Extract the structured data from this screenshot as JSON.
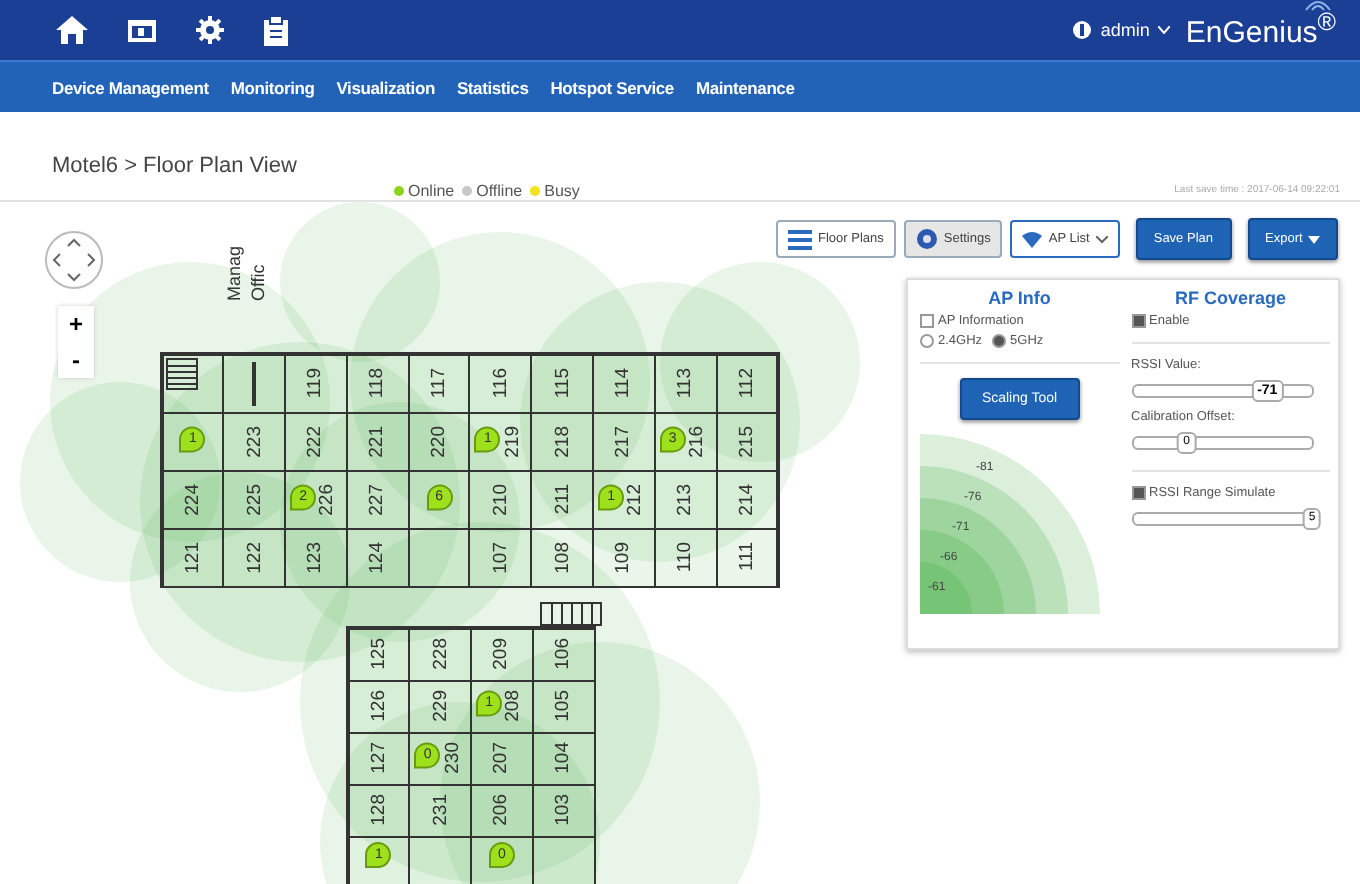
{
  "header": {
    "user": "admin",
    "logo": "EnGenius$^{®}$"
  },
  "nav": [
    "Device Management",
    "Monitoring",
    "Visualization",
    "Statistics",
    "Hotspot Service",
    "Maintenance"
  ],
  "breadcrumb": "Motel6 > Floor Plan View",
  "legend": [
    {
      "label": "Online",
      "color": "#8fd41c"
    },
    {
      "label": "Offline",
      "color": "#c8c8c8"
    },
    {
      "label": "Busy",
      "color": "#f2e21a"
    }
  ],
  "last_save": "Last save time : 2017-06-14 09:22:01",
  "zoom": {
    "in": "+",
    "out": "-"
  },
  "office_label": [
    "Manag",
    "Offic"
  ],
  "toolbar": {
    "floor_plans": "Floor Plans",
    "settings": "Settings",
    "ap_list": "AP List",
    "save": "Save Plan",
    "export": "Export"
  },
  "wing_a": [
    [
      {
        "kind": "stairs"
      },
      {
        "kind": "office"
      },
      {
        "kind": "room",
        "label": "119"
      },
      {
        "kind": "room",
        "label": "118"
      },
      {
        "kind": "room",
        "label": "117"
      },
      {
        "kind": "room",
        "label": "116"
      },
      {
        "kind": "room",
        "label": "115"
      },
      {
        "kind": "room",
        "label": "114"
      },
      {
        "kind": "room",
        "label": "113"
      },
      {
        "kind": "room",
        "label": "112"
      }
    ],
    [
      {
        "kind": "blank",
        "pin": "1"
      },
      {
        "kind": "room",
        "label": "223"
      },
      {
        "kind": "room",
        "label": "222"
      },
      {
        "kind": "room",
        "label": "221"
      },
      {
        "kind": "room",
        "label": "220"
      },
      {
        "kind": "room",
        "label": "219",
        "pin": "1"
      },
      {
        "kind": "room",
        "label": "218"
      },
      {
        "kind": "room",
        "label": "217"
      },
      {
        "kind": "room",
        "label": "216",
        "pin": "3"
      },
      {
        "kind": "room",
        "label": "215"
      }
    ],
    [
      {
        "kind": "room",
        "label": "224"
      },
      {
        "kind": "room",
        "label": "225"
      },
      {
        "kind": "room",
        "label": "226",
        "pin": "2"
      },
      {
        "kind": "room",
        "label": "227"
      },
      {
        "kind": "blank",
        "pin": "6"
      },
      {
        "kind": "room",
        "label": "210"
      },
      {
        "kind": "room",
        "label": "211"
      },
      {
        "kind": "room",
        "label": "212",
        "pin": "1"
      },
      {
        "kind": "room",
        "label": "213"
      },
      {
        "kind": "room",
        "label": "214"
      }
    ],
    [
      {
        "kind": "room",
        "label": "121"
      },
      {
        "kind": "room",
        "label": "122"
      },
      {
        "kind": "room",
        "label": "123"
      },
      {
        "kind": "room",
        "label": "124"
      },
      {
        "kind": "blank"
      },
      {
        "kind": "room",
        "label": "107"
      },
      {
        "kind": "room",
        "label": "108"
      },
      {
        "kind": "room",
        "label": "109"
      },
      {
        "kind": "room",
        "label": "110"
      },
      {
        "kind": "room",
        "label": "111"
      }
    ]
  ],
  "wing_b": [
    [
      {
        "kind": "room",
        "label": "125"
      },
      {
        "kind": "room",
        "label": "228"
      },
      {
        "kind": "room",
        "label": "209"
      },
      {
        "kind": "room",
        "label": "106"
      }
    ],
    [
      {
        "kind": "room",
        "label": "126"
      },
      {
        "kind": "room",
        "label": "229"
      },
      {
        "kind": "room",
        "label": "208",
        "pin": "1"
      },
      {
        "kind": "room",
        "label": "105"
      }
    ],
    [
      {
        "kind": "room",
        "label": "127"
      },
      {
        "kind": "room",
        "label": "230",
        "pin": "0"
      },
      {
        "kind": "room",
        "label": "207"
      },
      {
        "kind": "room",
        "label": "104"
      }
    ],
    [
      {
        "kind": "room",
        "label": "128"
      },
      {
        "kind": "room",
        "label": "231"
      },
      {
        "kind": "room",
        "label": "206"
      },
      {
        "kind": "room",
        "label": "103"
      }
    ],
    [
      {
        "kind": "blank",
        "pin": "1"
      },
      {
        "kind": "blank"
      },
      {
        "kind": "blank",
        "pin": "0"
      },
      {
        "kind": "blank"
      }
    ]
  ],
  "panel": {
    "ap_info": {
      "title": "AP Info",
      "ap_information": {
        "label": "AP Information",
        "checked": false
      },
      "bands": [
        {
          "label": "2.4GHz",
          "selected": false
        },
        {
          "label": "5GHz",
          "selected": true
        }
      ],
      "scaling_tool": "Scaling Tool",
      "scale": [
        "-81",
        "-76",
        "-71",
        "-66",
        "-61"
      ]
    },
    "rf": {
      "title": "RF Coverage",
      "enable": {
        "label": "Enable",
        "checked": true
      },
      "rssi": {
        "label": "RSSI Value:",
        "reading": "-71",
        "level": 0.75
      },
      "calibration": {
        "label": "Calibration Offset:",
        "reading": "0",
        "level": 0.3
      },
      "simulate": {
        "label": "RSSI Range Simulate",
        "checked": true,
        "reading": "5",
        "level": 1
      }
    }
  }
}
